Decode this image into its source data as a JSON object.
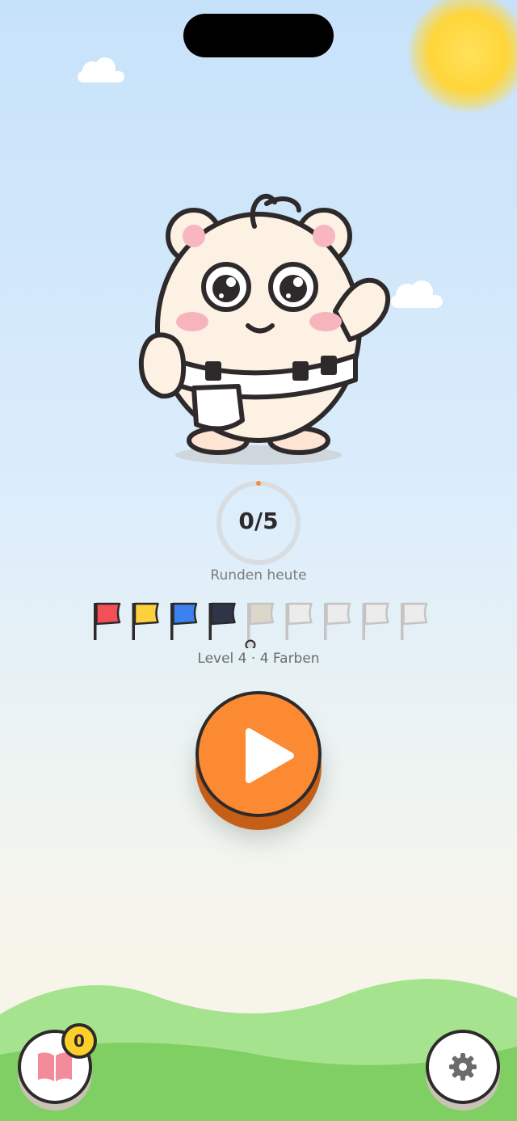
{
  "progress": {
    "count": "0/5",
    "completed": 0,
    "total": 5,
    "label": "Runden heute"
  },
  "level": {
    "label": "Level 4 · 4 Farben",
    "current_flag_index": 4
  },
  "flags": [
    {
      "name": "flag-red",
      "color": "#f24f57",
      "unlocked": true
    },
    {
      "name": "flag-yellow",
      "color": "#fdd13d",
      "unlocked": true
    },
    {
      "name": "flag-blue",
      "color": "#3b82f0",
      "unlocked": true
    },
    {
      "name": "flag-navy",
      "color": "#2f3449",
      "unlocked": true
    },
    {
      "name": "flag-beige",
      "color": "#ddd6cb",
      "unlocked": false
    },
    {
      "name": "flag-gray",
      "color": "#ececec",
      "unlocked": false
    },
    {
      "name": "flag-gray",
      "color": "#ececec",
      "unlocked": false
    },
    {
      "name": "flag-gray",
      "color": "#ececec",
      "unlocked": false
    },
    {
      "name": "flag-gray",
      "color": "#ececec",
      "unlocked": false
    }
  ],
  "play_button": {
    "icon": "play-icon",
    "color": "#fb8a32"
  },
  "book_button": {
    "icon": "book-icon",
    "badge_count": "0"
  },
  "settings_button": {
    "icon": "gear-icon"
  },
  "colors": {
    "outline": "#2e2a2b",
    "sky_top": "#c6e2fa",
    "grass": "#7fcf63",
    "sun": "#ffd63a"
  }
}
